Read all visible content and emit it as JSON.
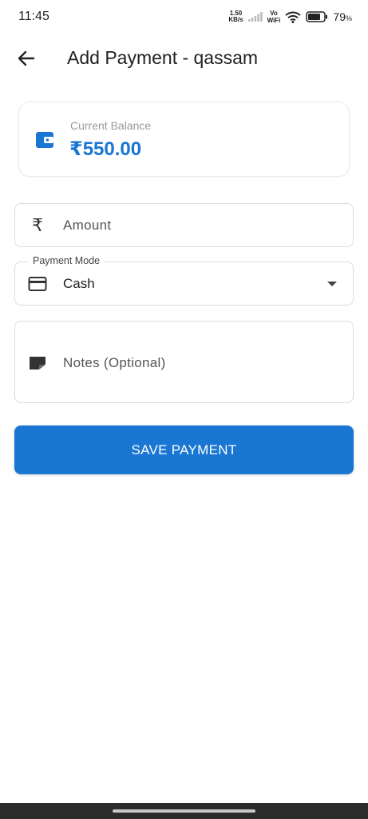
{
  "status_bar": {
    "time": "11:45",
    "net_speed_value": "1.50",
    "net_speed_unit": "KB/s",
    "volte_top": "Vo",
    "volte_bottom": "WiFi",
    "battery_percent": "79",
    "battery_unit": "%",
    "battery_level": 0.79,
    "icons": [
      "signal-icon",
      "wifi-icon",
      "battery-icon"
    ]
  },
  "app_bar": {
    "back_icon": "arrow-back-icon",
    "title": "Add Payment - qassam"
  },
  "balance_card": {
    "icon": "wallet-icon",
    "label": "Current Balance",
    "value": "₹550.00"
  },
  "form": {
    "amount": {
      "icon": "rupee-icon",
      "placeholder": "Amount",
      "value": ""
    },
    "payment_mode": {
      "icon": "credit-card-icon",
      "label": "Payment Mode",
      "value": "Cash",
      "dropdown_icon": "arrow-drop-down-icon"
    },
    "notes": {
      "icon": "note-icon",
      "placeholder": "Notes (Optional)",
      "value": ""
    },
    "save_label": "SAVE PAYMENT"
  },
  "colors": {
    "primary": "#1976d2",
    "balance_text": "#1976d2",
    "nav_bar": "#2b2b2b"
  }
}
